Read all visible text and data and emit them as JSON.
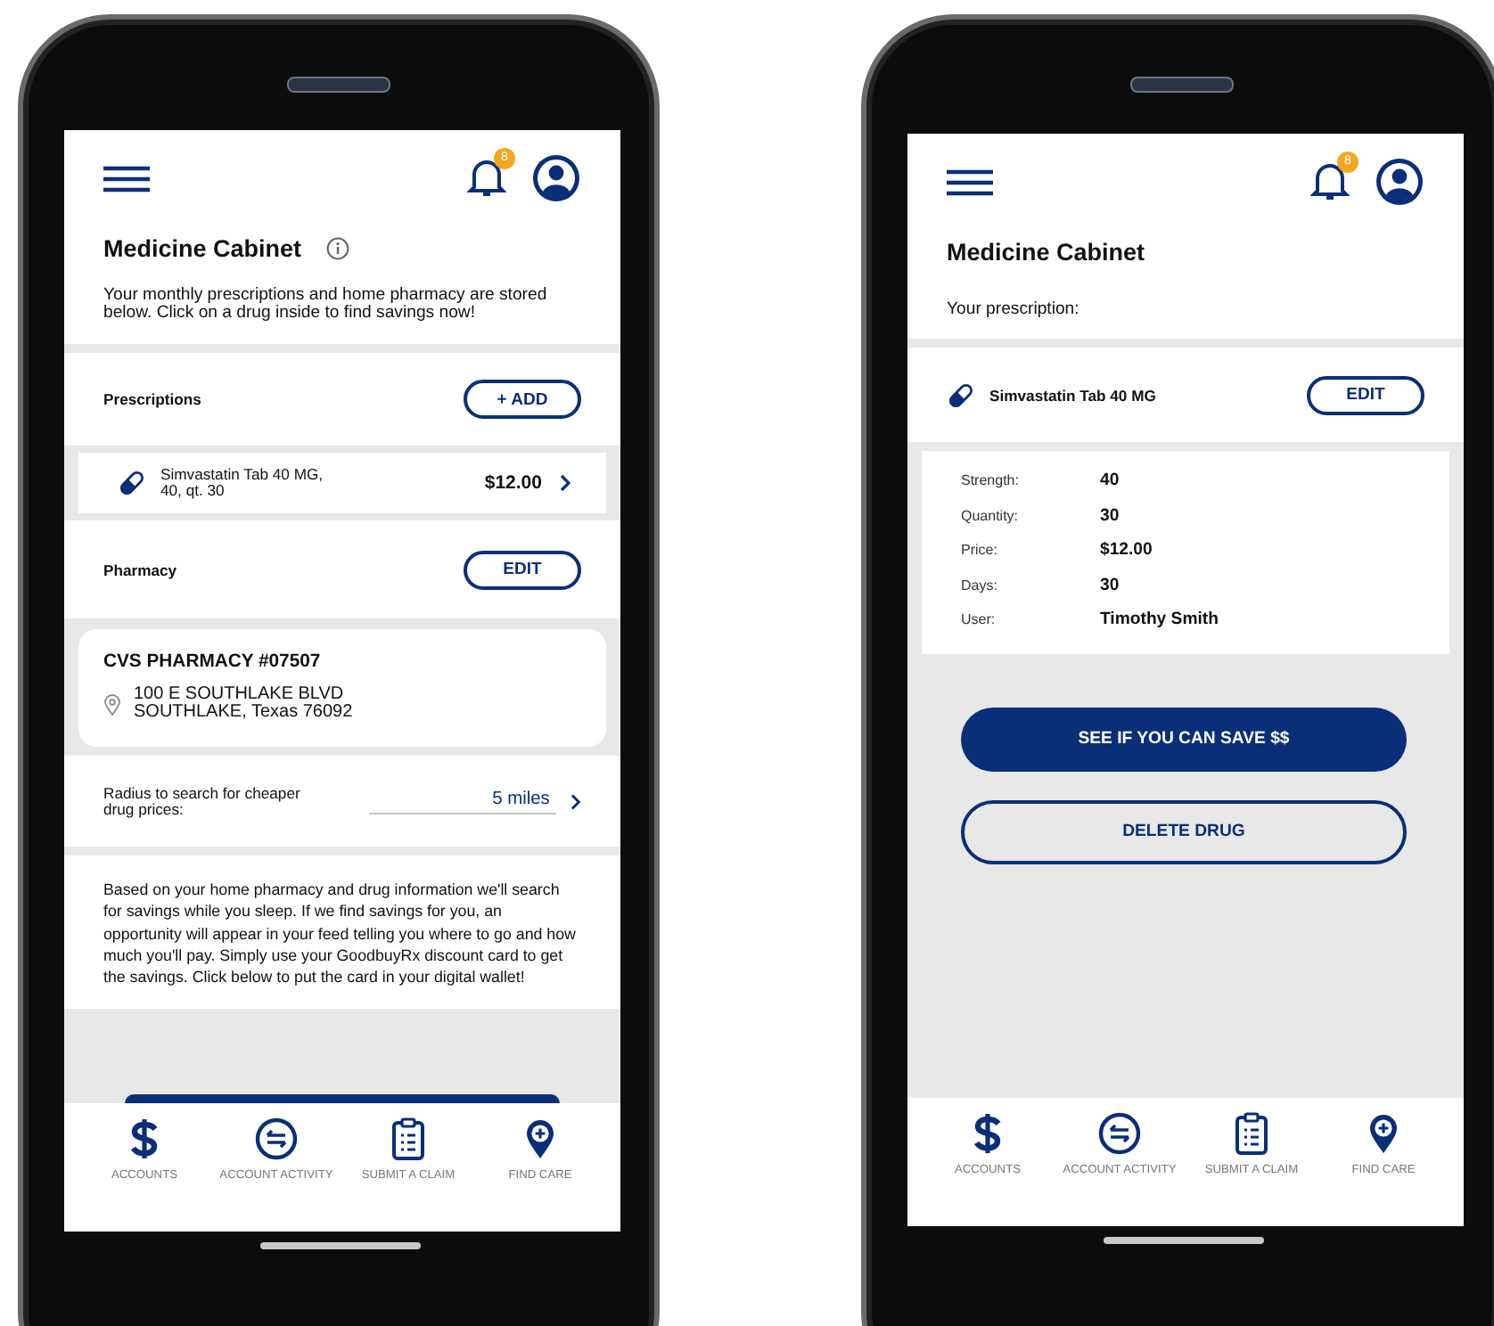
{
  "left_screen": {
    "badge": "8",
    "title": "Medicine Cabinet",
    "intro": "Your monthly prescriptions and home pharmacy are stored below. Click on a drug inside to find savings now!",
    "prescriptions": {
      "heading": "Prescriptions",
      "button": "+ ADD",
      "items": [
        {
          "name_lines": [
            "Simvastatin Tab 40 MG,",
            "40, qt. 30"
          ],
          "price": "$12.00"
        }
      ]
    },
    "pharmacy": {
      "heading": "Pharmacy",
      "button": "EDIT",
      "name": "CVS PHARMACY #07507",
      "address_lines": [
        "100 E SOUTHLAKE BLVD",
        "SOUTHLAKE, Texas 76092"
      ]
    },
    "radius": {
      "label": "Radius to search for cheaper drug prices:",
      "value": "5 miles"
    },
    "info": "Based on your home pharmacy and drug information we'll search for savings while you sleep. If we find savings for you, an opportunity will appear in your feed telling you where to go and how much you'll pay. Simply use your GoodbuyRx discount card to get the savings. Click below to put the card in your digital wallet!",
    "nav": [
      {
        "label": "ACCOUNTS",
        "kind": "dollar"
      },
      {
        "label": "ACCOUNT ACTIVITY",
        "kind": "exchange"
      },
      {
        "label": "SUBMIT A CLAIM",
        "kind": "clipboard"
      },
      {
        "label": "FIND CARE",
        "kind": "pin"
      }
    ]
  },
  "right_screen": {
    "badge": "8",
    "title": "Medicine Cabinet",
    "subtitle": "Your prescription:",
    "drug": {
      "name": "Simvastatin Tab 40 MG",
      "button": "EDIT"
    },
    "details": [
      {
        "label": "Strength:",
        "value": "40"
      },
      {
        "label": "Quantity:",
        "value": "30"
      },
      {
        "label": "Price:",
        "value": "$12.00"
      },
      {
        "label": "Days:",
        "value": "30"
      },
      {
        "label": "User:",
        "value": "Timothy Smith"
      }
    ],
    "actions": [
      {
        "label": "SEE IF YOU CAN SAVE $$",
        "kind": "primary"
      },
      {
        "label": "DELETE DRUG",
        "kind": "secondary"
      }
    ],
    "nav": [
      {
        "label": "ACCOUNTS",
        "kind": "dollar"
      },
      {
        "label": "ACCOUNT ACTIVITY",
        "kind": "exchange"
      },
      {
        "label": "SUBMIT A CLAIM",
        "kind": "clipboard"
      },
      {
        "label": "FIND CARE",
        "kind": "pin"
      }
    ]
  }
}
